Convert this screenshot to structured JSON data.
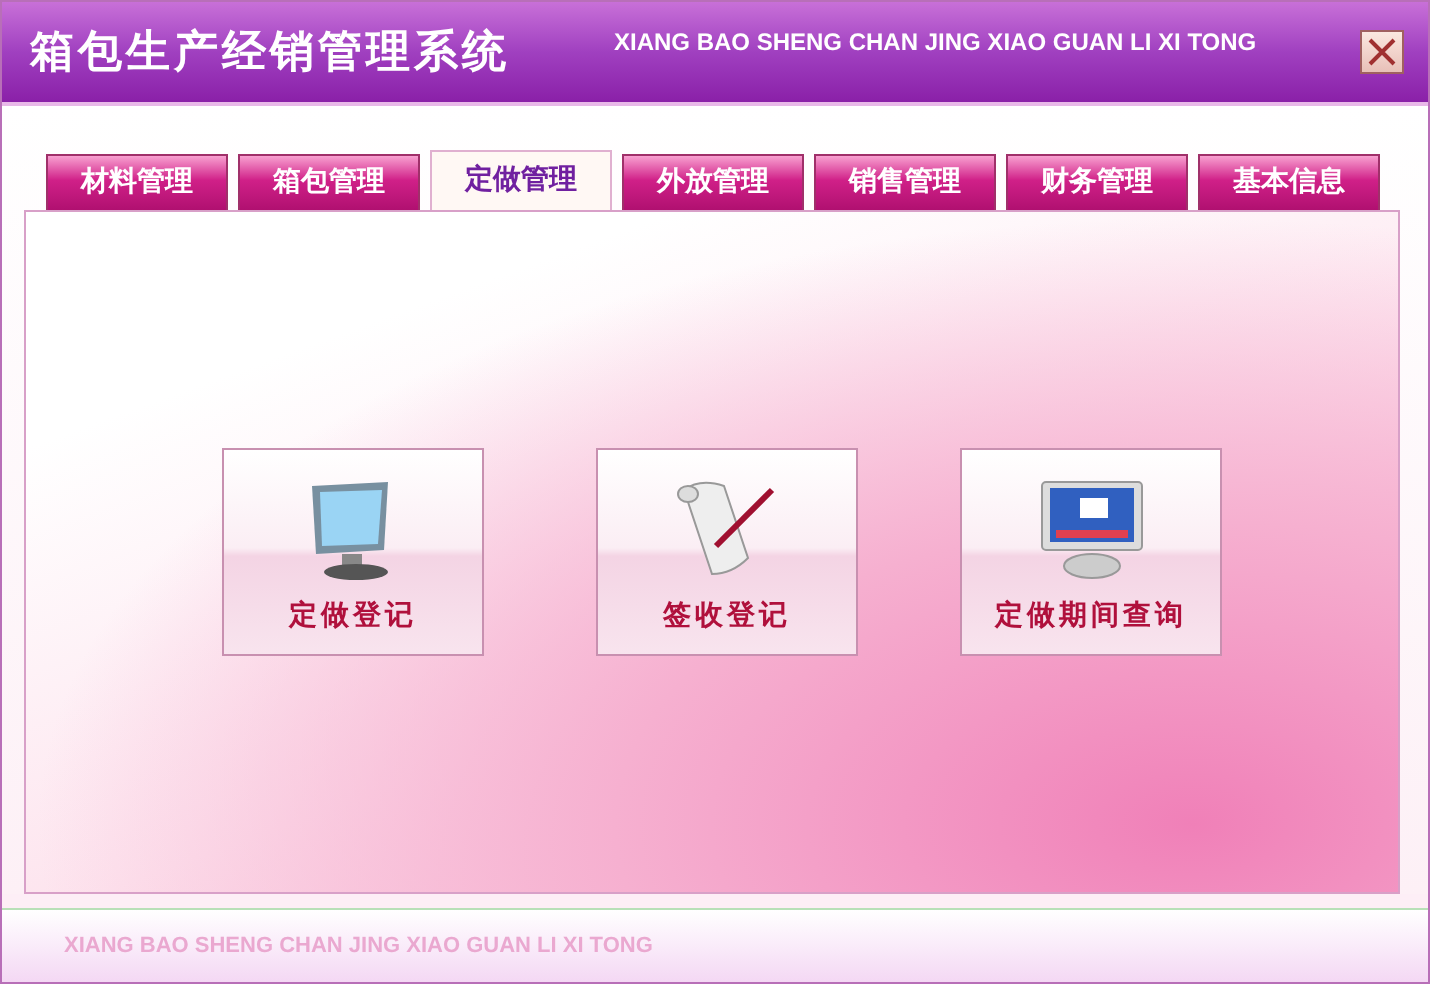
{
  "window": {
    "title": "箱包生产经销管理系统",
    "subtitle": "XIANG BAO SHENG CHAN JING XIAO GUAN LI XI TONG"
  },
  "tabs": [
    {
      "label": "材料管理",
      "selected": false
    },
    {
      "label": "箱包管理",
      "selected": false
    },
    {
      "label": "定做管理",
      "selected": true
    },
    {
      "label": "外放管理",
      "selected": false
    },
    {
      "label": "销售管理",
      "selected": false
    },
    {
      "label": "财务管理",
      "selected": false
    },
    {
      "label": "基本信息",
      "selected": false
    }
  ],
  "actions": [
    {
      "label": "定做登记",
      "kind": "monitor"
    },
    {
      "label": "签收登记",
      "kind": "scroll"
    },
    {
      "label": "定做期间查询",
      "kind": "screen"
    }
  ],
  "footer": {
    "text": "XIANG BAO SHENG CHAN JING XIAO GUAN LI XI TONG"
  }
}
